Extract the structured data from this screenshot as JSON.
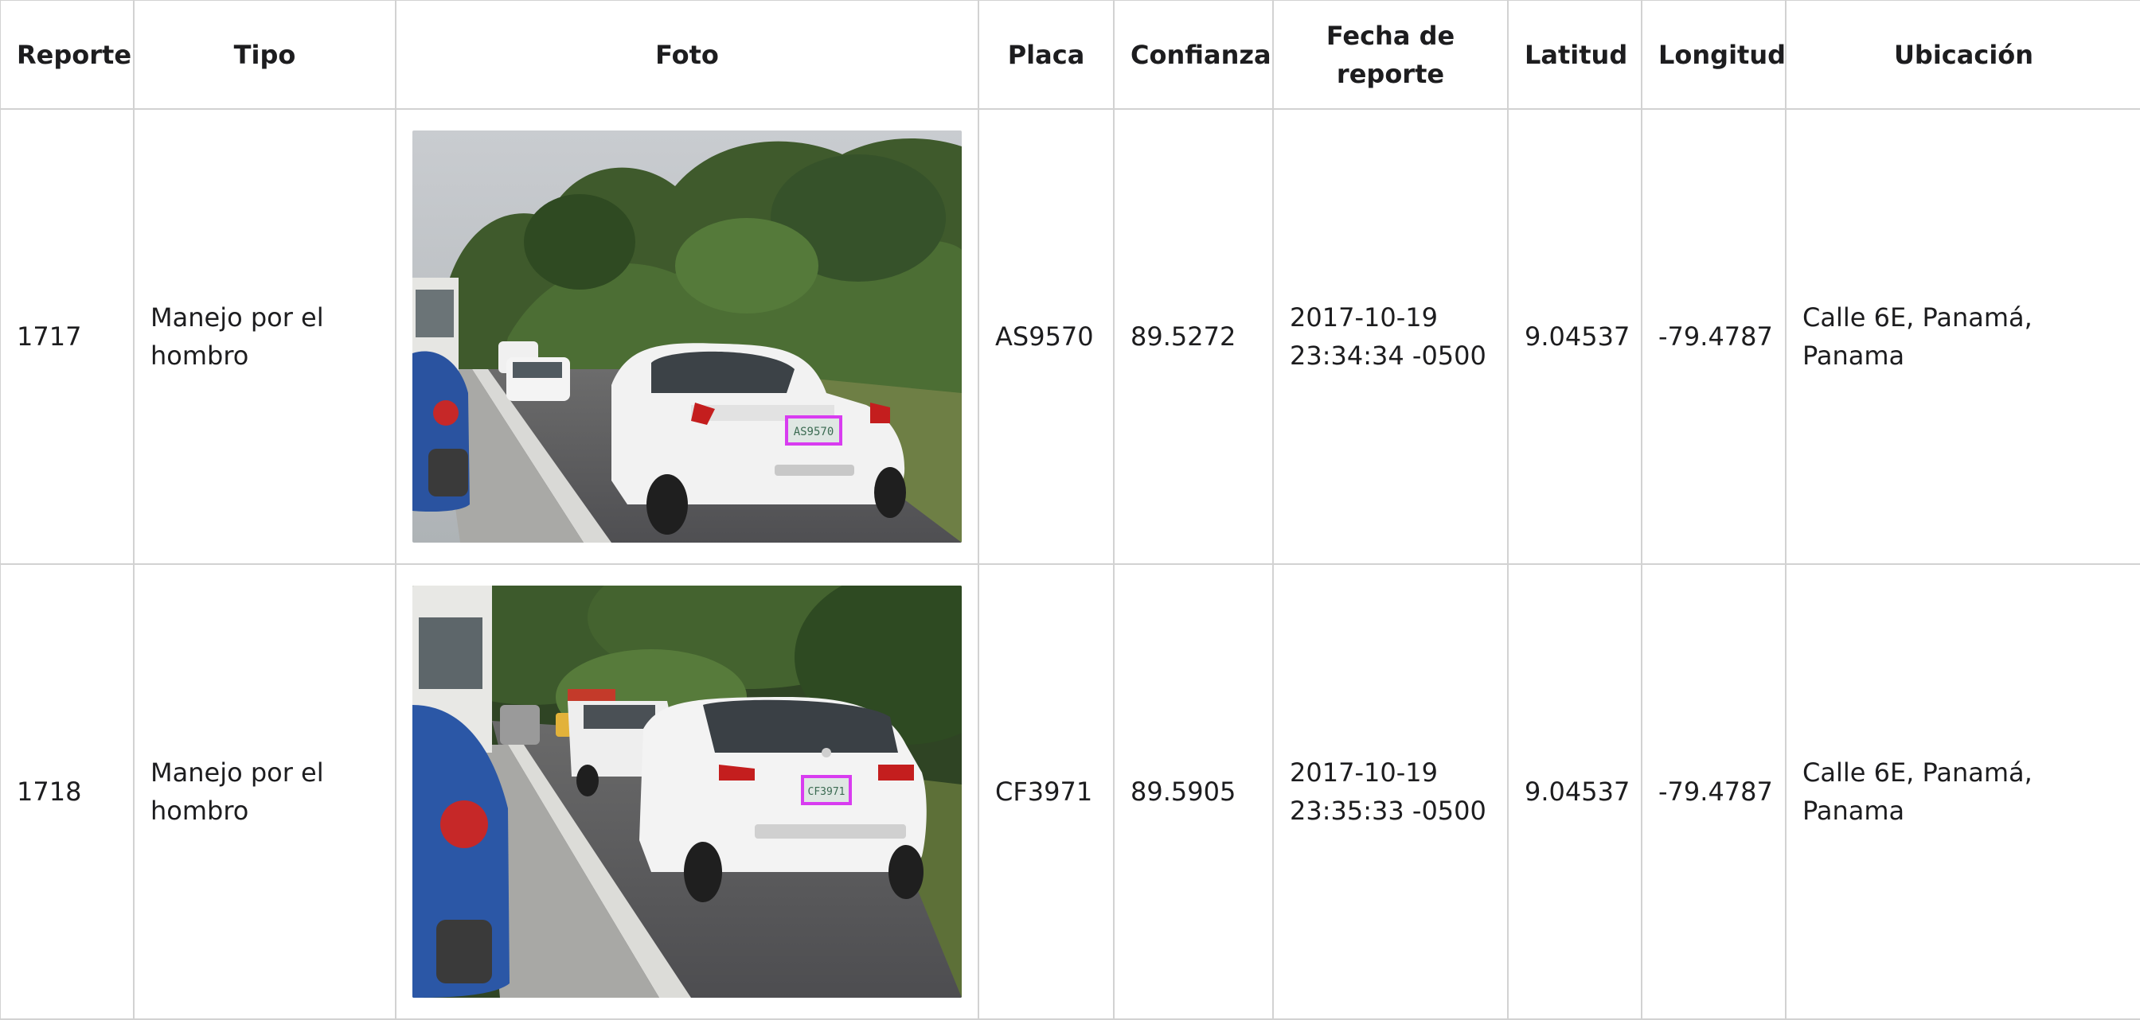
{
  "table": {
    "headers": {
      "report": "Reporte",
      "type": "Tipo",
      "photo": "Foto",
      "plate": "Placa",
      "confidence": "Confianza",
      "date_line1": "Fecha de",
      "date_line2": "reporte",
      "latitude": "Latitud",
      "longitude": "Longitud",
      "location": "Ubicación"
    },
    "rows": [
      {
        "report": "1717",
        "type_line1": "Manejo por el",
        "type_line2": "hombro",
        "plate": "AS9570",
        "confidence": "89.5272",
        "date_line1": "2017-10-19",
        "date_line2": "23:34:34 -0500",
        "latitude": "9.04537",
        "longitude": "-79.4787",
        "location": "Calle 6E, Panamá, Panama",
        "photo_plate": "AS9570"
      },
      {
        "report": "1718",
        "type_line1": "Manejo por el",
        "type_line2": "hombro",
        "plate": "CF3971",
        "confidence": "89.5905",
        "date_line1": "2017-10-19",
        "date_line2": "23:35:33 -0500",
        "latitude": "9.04537",
        "longitude": "-79.4787",
        "location": "Calle 6E, Panamá, Panama",
        "photo_plate": "CF3971"
      }
    ]
  },
  "colors": {
    "border": "#d2d2d2",
    "text": "#1d1d1f",
    "detection_box": "#d83cf0"
  }
}
